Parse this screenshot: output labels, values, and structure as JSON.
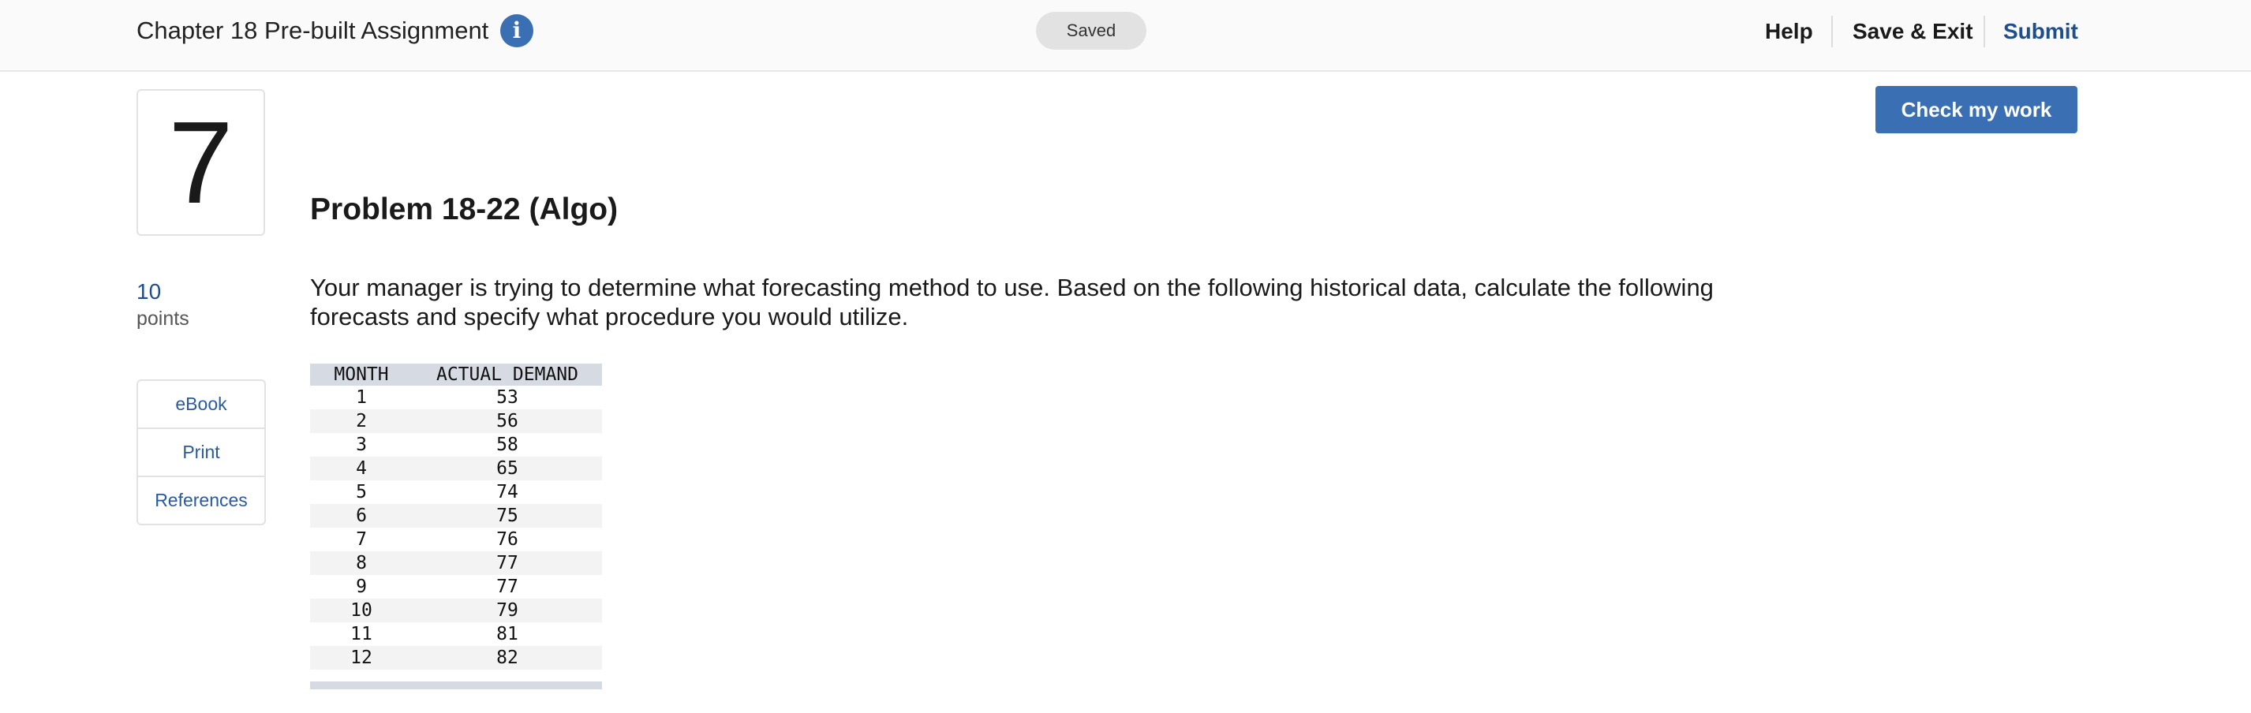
{
  "header": {
    "assignment_title": "Chapter 18 Pre-built Assignment",
    "info_icon": "info-icon",
    "status": "Saved",
    "nav": {
      "help": "Help",
      "save_exit": "Save & Exit",
      "submit": "Submit"
    }
  },
  "question": {
    "number": "7",
    "points_value": "10",
    "points_label": "points",
    "resources": [
      "eBook",
      "Print",
      "References"
    ]
  },
  "check_button": "Check my work",
  "problem": {
    "title": "Problem 18-22 (Algo)",
    "text": "Your manager is trying to determine what forecasting method to use. Based on the following historical data, calculate the following forecasts and specify what procedure you would utilize."
  },
  "table": {
    "headers": [
      "MONTH",
      "ACTUAL DEMAND"
    ],
    "rows": [
      [
        "1",
        "53"
      ],
      [
        "2",
        "56"
      ],
      [
        "3",
        "58"
      ],
      [
        "4",
        "65"
      ],
      [
        "5",
        "74"
      ],
      [
        "6",
        "75"
      ],
      [
        "7",
        "76"
      ],
      [
        "8",
        "77"
      ],
      [
        "9",
        "77"
      ],
      [
        "10",
        "79"
      ],
      [
        "11",
        "81"
      ],
      [
        "12",
        "82"
      ]
    ]
  },
  "colors": {
    "accent": "#3b6fb3",
    "link": "#2a5a9e",
    "submit": "#1f4e8c"
  }
}
